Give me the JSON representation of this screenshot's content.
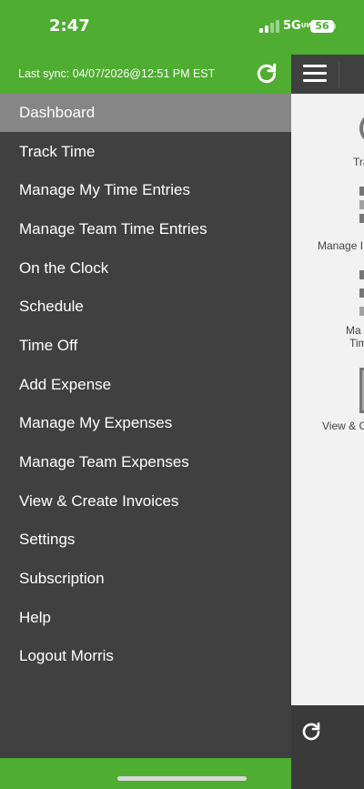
{
  "status_bar": {
    "time": "2:47",
    "network": "5G",
    "network_sub": "UW",
    "battery": "56"
  },
  "drawer": {
    "sync_text": "Last sync: 04/07/2026@12:51 PM EST",
    "refresh_icon": "refresh-icon",
    "menu": [
      {
        "label": "Dashboard",
        "active": true
      },
      {
        "label": "Track Time"
      },
      {
        "label": "Manage My Time Entries"
      },
      {
        "label": "Manage Team Time Entries"
      },
      {
        "label": "On the Clock"
      },
      {
        "label": "Schedule"
      },
      {
        "label": "Time Off"
      },
      {
        "label": "Add Expense"
      },
      {
        "label": "Manage My Expenses"
      },
      {
        "label": "Manage Team Expenses"
      },
      {
        "label": "View & Create Invoices"
      },
      {
        "label": "Settings"
      },
      {
        "label": "Subscription"
      },
      {
        "label": "Help"
      },
      {
        "label": "Logout Morris"
      }
    ]
  },
  "background_app": {
    "menu_icon": "hamburger-icon",
    "labels": [
      "Tra",
      "Manage I",
      "Ma",
      "Tim",
      "View & C"
    ]
  },
  "colors": {
    "brand_green": "#4fad31",
    "drawer_bg": "#404040",
    "active_item": "#868686"
  }
}
